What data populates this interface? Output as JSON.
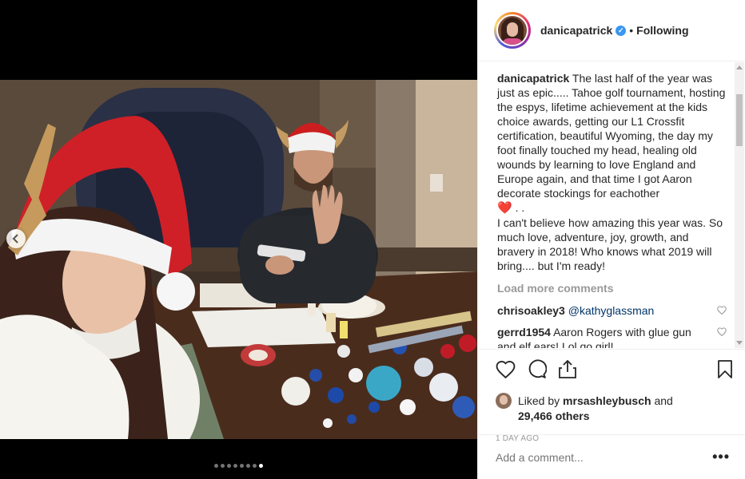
{
  "post": {
    "username": "danicapatrick",
    "separator": "•",
    "follow_label": "Following"
  },
  "caption": {
    "username": "danicapatrick",
    "text_part1": "The last half of the year was just as epic..... Tahoe golf tournament, hosting the espys, lifetime achievement at the kids choice awards, getting our L1 Crossfit certification, beautiful Wyoming, the day my foot finally touched my head, healing old wounds by learning to love England and Europe again, and that time I got Aaron decorate stockings for eachother",
    "heart_emoji": "❤️",
    "text_after_heart": ". .",
    "text_part2": "I can't believe how amazing this year was. So much love, adventure, joy, growth, and bravery in 2018! Who knows what 2019 will bring.... but I'm ready!"
  },
  "load_more": "Load more comments",
  "comments": [
    {
      "user": "chrisoakley3",
      "mention": "@kathyglassman",
      "text": ""
    },
    {
      "user": "gerrd1954",
      "mention": "",
      "text": "Aaron Rogers with glue gun and elf ears! Lol go girl!"
    }
  ],
  "likes": {
    "prefix": "Liked by",
    "user": "mrsashleybusch",
    "conj": "and",
    "others": "29,466 others"
  },
  "timestamp": "1 DAY AGO",
  "add_comment_placeholder": "Add a comment...",
  "more_options": "•••",
  "carousel": {
    "count": 8,
    "active_index": 7
  },
  "icons": {
    "heart": "heart-icon",
    "comment": "comment-icon",
    "share": "share-icon",
    "save": "bookmark-icon",
    "prev": "chevron-left-icon"
  },
  "colors": {
    "verified": "#3897f0",
    "mention": "#003569",
    "muted": "#999999",
    "heart_emoji": "#e0245e"
  }
}
